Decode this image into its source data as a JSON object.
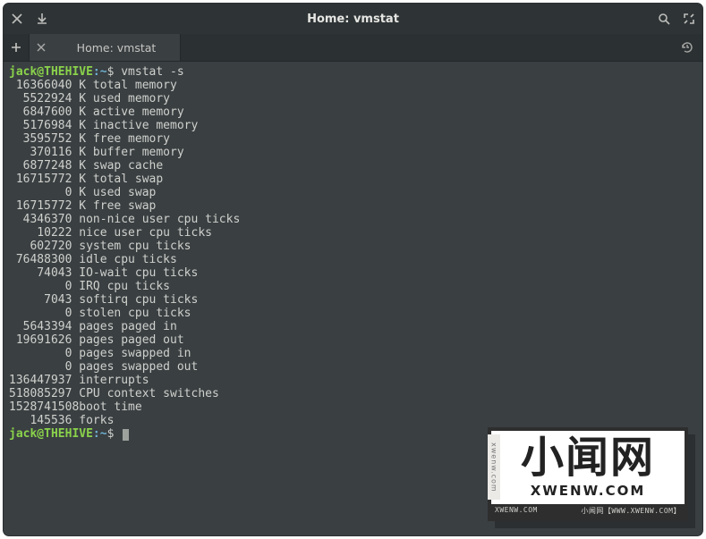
{
  "titlebar": {
    "title": "Home: vmstat"
  },
  "tabs": [
    {
      "label": "Home: vmstat"
    }
  ],
  "prompt": {
    "user": "jack@THEHIVE",
    "sep": ":",
    "path": "~",
    "sigil": "$",
    "command": "vmstat -s"
  },
  "output": [
    {
      "value": "16366040",
      "label": "K total memory"
    },
    {
      "value": "5522924",
      "label": "K used memory"
    },
    {
      "value": "6847600",
      "label": "K active memory"
    },
    {
      "value": "5176984",
      "label": "K inactive memory"
    },
    {
      "value": "3595752",
      "label": "K free memory"
    },
    {
      "value": "370116",
      "label": "K buffer memory"
    },
    {
      "value": "6877248",
      "label": "K swap cache"
    },
    {
      "value": "16715772",
      "label": "K total swap"
    },
    {
      "value": "0",
      "label": "K used swap"
    },
    {
      "value": "16715772",
      "label": "K free swap"
    },
    {
      "value": "4346370",
      "label": "non-nice user cpu ticks"
    },
    {
      "value": "10222",
      "label": "nice user cpu ticks"
    },
    {
      "value": "602720",
      "label": "system cpu ticks"
    },
    {
      "value": "76488300",
      "label": "idle cpu ticks"
    },
    {
      "value": "74043",
      "label": "IO-wait cpu ticks"
    },
    {
      "value": "0",
      "label": "IRQ cpu ticks"
    },
    {
      "value": "7043",
      "label": "softirq cpu ticks"
    },
    {
      "value": "0",
      "label": "stolen cpu ticks"
    },
    {
      "value": "5643394",
      "label": "pages paged in"
    },
    {
      "value": "19691626",
      "label": "pages paged out"
    },
    {
      "value": "0",
      "label": "pages swapped in"
    },
    {
      "value": "0",
      "label": "pages swapped out"
    },
    {
      "value": "136447937",
      "label": "interrupts"
    },
    {
      "value": "518085297",
      "label": "CPU context switches"
    },
    {
      "value": "1528741508",
      "label": "boot time"
    },
    {
      "value": "145536",
      "label": "forks"
    }
  ],
  "watermark": {
    "big": "小闻网",
    "sub": "XWENW.COM",
    "side": "xwenw.com",
    "left": "XWENW.COM",
    "right": "小闻网【WWW.XWENW.COM】"
  }
}
